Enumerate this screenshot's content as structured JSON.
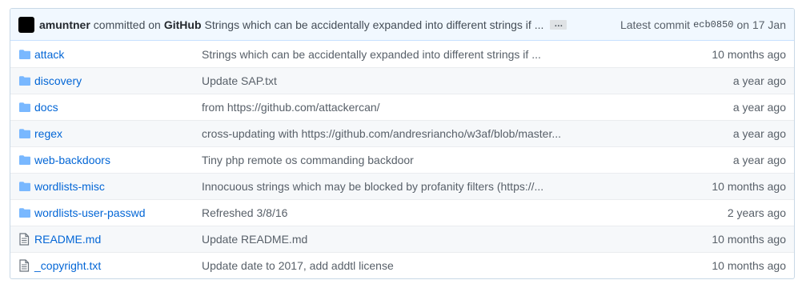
{
  "commit": {
    "author": "amuntner",
    "committed_text": "committed on",
    "via": "GitHub",
    "message": "Strings which can be accidentally expanded into different strings if ...",
    "ellipsis": "…",
    "latest_label": "Latest commit",
    "sha": "ecb0850",
    "date_text": "on 17 Jan"
  },
  "files": [
    {
      "icon": "folder-icon",
      "name": "attack",
      "message": "Strings which can be accidentally expanded into different strings if ...",
      "age": "10 months ago"
    },
    {
      "icon": "folder-icon",
      "name": "discovery",
      "message": "Update SAP.txt",
      "age": "a year ago"
    },
    {
      "icon": "folder-icon",
      "name": "docs",
      "message": "from https://github.com/attackercan/",
      "age": "a year ago"
    },
    {
      "icon": "folder-icon",
      "name": "regex",
      "message": "cross-updating with https://github.com/andresriancho/w3af/blob/master...",
      "age": "a year ago"
    },
    {
      "icon": "folder-icon",
      "name": "web-backdoors",
      "message": "Tiny php remote os commanding backdoor",
      "age": "a year ago"
    },
    {
      "icon": "folder-icon",
      "name": "wordlists-misc",
      "message": "Innocuous strings which may be blocked by profanity filters (https://...",
      "age": "10 months ago"
    },
    {
      "icon": "folder-icon",
      "name": "wordlists-user-passwd",
      "message": "Refreshed 3/8/16",
      "age": "2 years ago"
    },
    {
      "icon": "file-icon",
      "name": "README.md",
      "message": "Update README.md",
      "age": "10 months ago"
    },
    {
      "icon": "file-icon",
      "name": "_copyright.txt",
      "message": "Update date to 2017, add addtl license",
      "age": "10 months ago"
    }
  ],
  "colors": {
    "link": "#0366d6",
    "folder": "#79b8ff",
    "file_icon": "#6a737d",
    "commit_bar_bg": "#f1f8ff"
  }
}
